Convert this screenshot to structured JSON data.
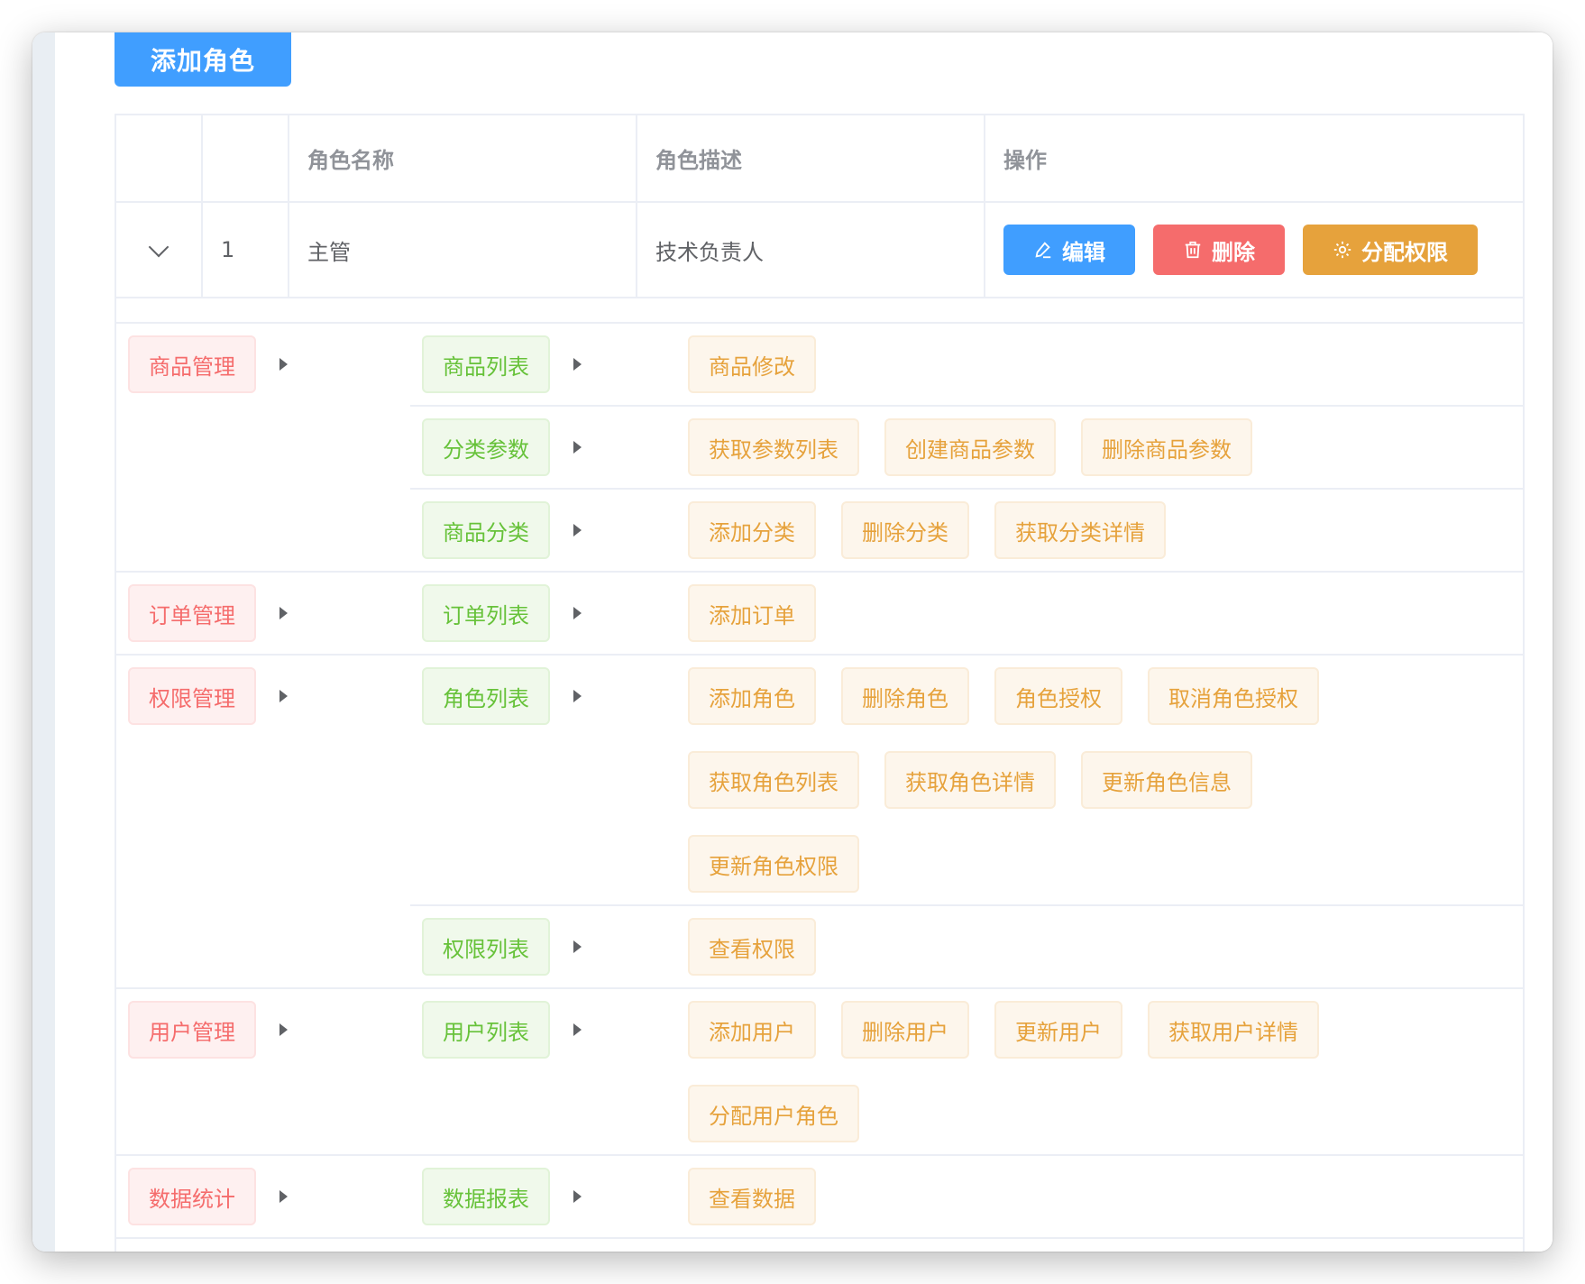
{
  "toolbar": {
    "add_role_label": "添加角色"
  },
  "table": {
    "headers": {
      "expand": "",
      "index": "",
      "name": "角色名称",
      "desc": "角色描述",
      "ops": "操作"
    },
    "row": {
      "index": "1",
      "name": "主管",
      "desc": "技术负责人",
      "edit_label": "编辑",
      "delete_label": "删除",
      "assign_label": "分配权限"
    }
  },
  "colors": {
    "primary": "#409eff",
    "danger": "#f56c6c",
    "warning": "#e6a23c",
    "success": "#67c23a"
  },
  "rights": [
    {
      "name": "商品管理",
      "children": [
        {
          "name": "商品列表",
          "children": [
            "商品修改"
          ]
        },
        {
          "name": "分类参数",
          "children": [
            "获取参数列表",
            "创建商品参数",
            "删除商品参数"
          ]
        },
        {
          "name": "商品分类",
          "children": [
            "添加分类",
            "删除分类",
            "获取分类详情"
          ]
        }
      ]
    },
    {
      "name": "订单管理",
      "children": [
        {
          "name": "订单列表",
          "children": [
            "添加订单"
          ]
        }
      ]
    },
    {
      "name": "权限管理",
      "children": [
        {
          "name": "角色列表",
          "children": [
            "添加角色",
            "删除角色",
            "角色授权",
            "取消角色授权",
            "获取角色列表",
            "获取角色详情",
            "更新角色信息",
            "更新角色权限"
          ]
        },
        {
          "name": "权限列表",
          "children": [
            "查看权限"
          ]
        }
      ]
    },
    {
      "name": "用户管理",
      "children": [
        {
          "name": "用户列表",
          "children": [
            "添加用户",
            "删除用户",
            "更新用户",
            "获取用户详情",
            "分配用户角色"
          ]
        }
      ]
    },
    {
      "name": "数据统计",
      "children": [
        {
          "name": "数据报表",
          "children": [
            "查看数据"
          ]
        }
      ]
    }
  ]
}
